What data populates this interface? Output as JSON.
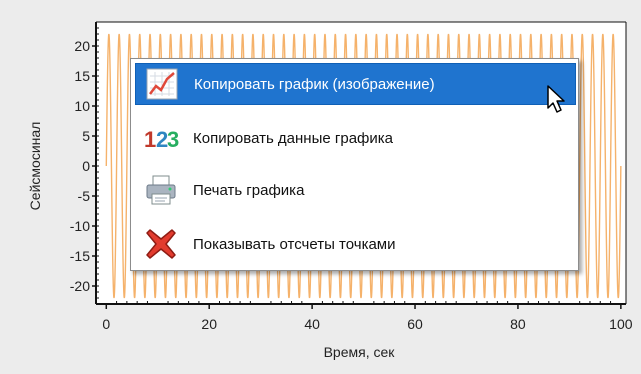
{
  "chart_data": {
    "type": "line",
    "title": "",
    "xlabel": "Время, сек",
    "ylabel": "Сейсмосинал",
    "xlim": [
      -2,
      101
    ],
    "ylim": [
      -23,
      24
    ],
    "x_ticks": [
      "0",
      "20",
      "40",
      "60",
      "80",
      "100"
    ],
    "y_ticks": [
      "20",
      "15",
      "10",
      "5",
      "0",
      "-5",
      "-10",
      "-15",
      "-20"
    ],
    "grid": false,
    "legend": "none",
    "series": [
      {
        "amplitude": 22,
        "period": 2,
        "x_range": [
          0,
          100
        ],
        "color": "#f5b26b"
      }
    ]
  },
  "menu": {
    "items": [
      {
        "label": "Копировать график (изображение)",
        "icon": "chart-image-icon",
        "active": true
      },
      {
        "label": "Копировать данные графика",
        "icon": "numbers-123-icon",
        "active": false
      },
      {
        "label": "Печать графика",
        "icon": "printer-icon",
        "active": false
      },
      {
        "label": "Показывать отсчеты точками",
        "icon": "red-cross-icon",
        "active": false
      }
    ]
  },
  "colors": {
    "series": "#f5b26b",
    "menu_highlight": "#1f74cf",
    "axis": "#111111"
  }
}
